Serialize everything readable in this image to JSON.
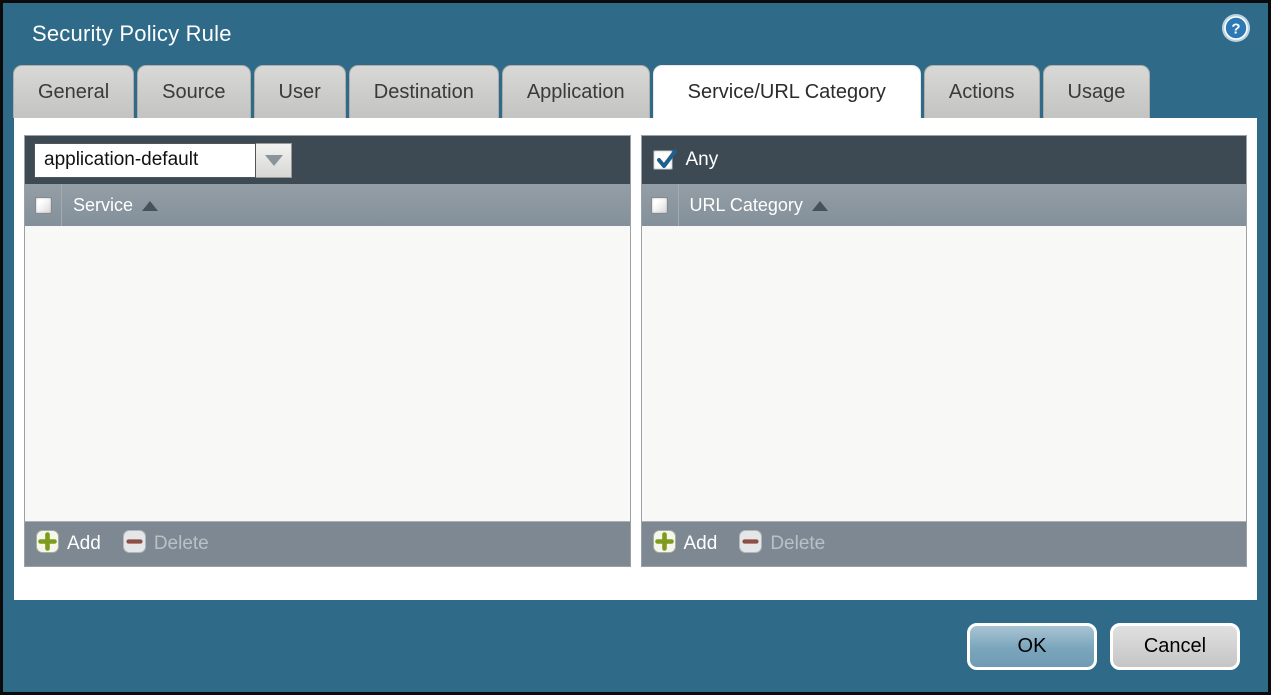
{
  "window": {
    "title": "Security Policy Rule"
  },
  "tabs": [
    {
      "label": "General",
      "active": false
    },
    {
      "label": "Source",
      "active": false
    },
    {
      "label": "User",
      "active": false
    },
    {
      "label": "Destination",
      "active": false
    },
    {
      "label": "Application",
      "active": false
    },
    {
      "label": "Service/URL Category",
      "active": true
    },
    {
      "label": "Actions",
      "active": false
    },
    {
      "label": "Usage",
      "active": false
    }
  ],
  "service_panel": {
    "dropdown_value": "application-default",
    "column_header": "Service",
    "select_all_checked": false,
    "sort": "asc",
    "rows": [],
    "add_label": "Add",
    "delete_label": "Delete",
    "delete_enabled": false
  },
  "url_category_panel": {
    "any_label": "Any",
    "any_checked": true,
    "column_header": "URL Category",
    "select_all_checked": false,
    "sort": "asc",
    "rows": [],
    "add_label": "Add",
    "delete_label": "Delete",
    "delete_enabled": false
  },
  "footer": {
    "ok_label": "OK",
    "cancel_label": "Cancel"
  },
  "icons": {
    "help": "help-icon",
    "dropdown": "chevron-down-icon",
    "sort": "sort-ascending-icon",
    "add": "plus-icon",
    "delete": "minus-icon",
    "check": "checkmark-icon"
  },
  "colors": {
    "dialog_teal": "#2f6b88",
    "panel_header_dark": "#3d4a54",
    "column_header_gray": "#8a949c",
    "toolbar_gray": "#7e8892",
    "add_green": "#7e9b1e",
    "delete_red": "#8d4f45",
    "check_blue": "#1d5f8e",
    "ok_button_blue": "#7aa5bc",
    "cancel_button_gray": "#c5c5c5"
  }
}
